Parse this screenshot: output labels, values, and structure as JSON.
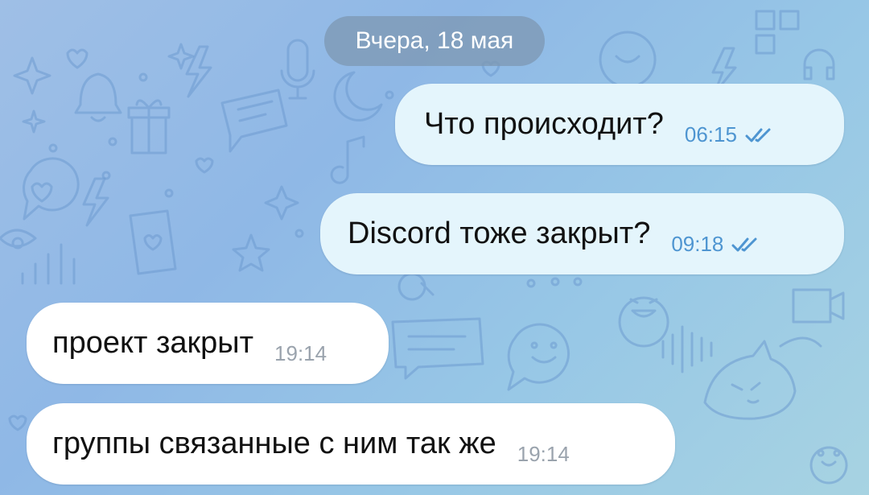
{
  "chat": {
    "date_separator": "Вчера, 18 мая",
    "messages": [
      {
        "direction": "outgoing",
        "text": "Что происходит?",
        "time": "06:15",
        "status": "read",
        "status_icon": "double-check-icon"
      },
      {
        "direction": "outgoing",
        "text": "Discord тоже закрыт?",
        "time": "09:18",
        "status": "read",
        "status_icon": "double-check-icon"
      },
      {
        "direction": "incoming",
        "text": "проект закрыт",
        "time": "19:14"
      },
      {
        "direction": "incoming",
        "text": "группы связанные с ним так же",
        "time": "19:14"
      }
    ]
  },
  "colors": {
    "outgoing_bubble": "#e4f5fc",
    "incoming_bubble": "#ffffff",
    "outgoing_meta": "#4e95d1",
    "incoming_meta": "#9aa3ad",
    "date_chip": "#7d98b4"
  }
}
